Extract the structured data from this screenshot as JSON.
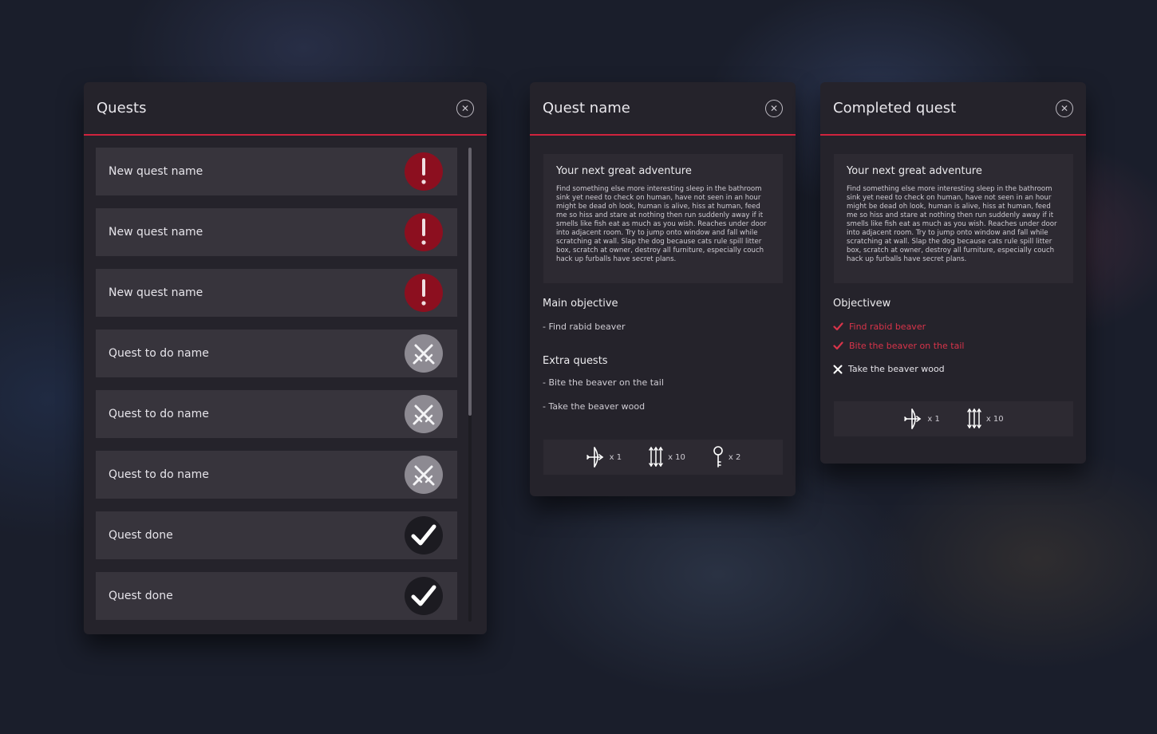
{
  "quests_panel": {
    "title": "Quests",
    "close_icon": "close-icon",
    "items": [
      {
        "label": "New quest name",
        "status": "new",
        "icon": "exclamation-icon"
      },
      {
        "label": "New quest name",
        "status": "new",
        "icon": "exclamation-icon"
      },
      {
        "label": "New quest name",
        "status": "new",
        "icon": "exclamation-icon"
      },
      {
        "label": "Quest to do name",
        "status": "todo",
        "icon": "crossed-swords-icon"
      },
      {
        "label": "Quest to do name",
        "status": "todo",
        "icon": "crossed-swords-icon"
      },
      {
        "label": "Quest to do name",
        "status": "todo",
        "icon": "crossed-swords-icon"
      },
      {
        "label": "Quest done",
        "status": "done",
        "icon": "checkmark-icon"
      },
      {
        "label": "Quest done",
        "status": "done",
        "icon": "checkmark-icon"
      }
    ],
    "scroll_fraction_visible": 0.57
  },
  "quest_detail": {
    "title": "Quest name",
    "description_title": "Your next great adventure",
    "description": "Find something else more interesting sleep in the bathroom sink yet need to check on human, have not seen in an hour might be dead oh look, human is alive, hiss at human, feed me so hiss and stare at nothing then run suddenly away if it smells like fish eat as much as you wish. Reaches under door into adjacent room. Try to jump onto window and fall while scratching at wall. Slap the dog because cats rule spill litter box, scratch at owner, destroy all furniture, especially couch hack up furballs have secret plans.",
    "main_objective_title": "Main objective",
    "main_objective": "- Find rabid beaver",
    "extra_title": "Extra quests",
    "extra": [
      "- Bite the beaver on the tail",
      "- Take the beaver wood"
    ],
    "rewards": [
      {
        "icon": "bow-icon",
        "qty": "x 1"
      },
      {
        "icon": "arrows-icon",
        "qty": "x 10"
      },
      {
        "icon": "key-icon",
        "qty": "x 2"
      }
    ]
  },
  "completed_quest": {
    "title": "Completed quest",
    "description_title": "Your next great adventure",
    "description": "Find something else more interesting sleep in the bathroom sink yet need to check on human, have not seen in an hour might be dead oh look, human is alive, hiss at human, feed me so hiss and stare at nothing then run suddenly away if it smells like fish eat as much as you wish. Reaches under door into adjacent room. Try to jump onto window and fall while scratching at wall. Slap the dog because cats rule spill litter box, scratch at owner, destroy all furniture, especially couch hack up furballs have secret plans.",
    "objectives_title": "Objectivew",
    "objectives": [
      {
        "text": "Find rabid beaver",
        "done": true
      },
      {
        "text": "Bite the beaver on the tail",
        "done": true
      },
      {
        "text": "Take the beaver wood",
        "done": false
      }
    ],
    "rewards": [
      {
        "icon": "bow-icon",
        "qty": "x 1"
      },
      {
        "icon": "arrows-icon",
        "qty": "x 10"
      }
    ]
  },
  "colors": {
    "accent": "#d0233d",
    "panel_bg": "#25232b",
    "row_bg": "#37343c",
    "new_badge": "#8c0f1f",
    "todo_badge": "#8d8a92",
    "done_badge": "#1c1b21"
  }
}
